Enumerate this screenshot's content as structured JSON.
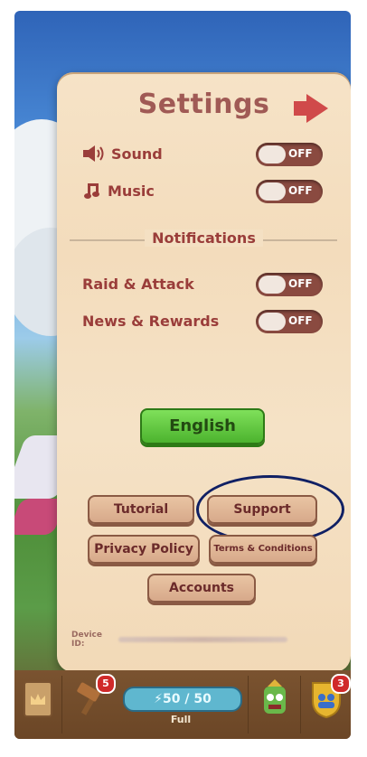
{
  "settings": {
    "title": "Settings",
    "sound_label": "Sound",
    "music_label": "Music",
    "notifications_label": "Notifications",
    "raid_attack_label": "Raid & Attack",
    "news_rewards_label": "News & Rewards",
    "toggle_off": "OFF",
    "language_button": "English",
    "tutorial_button": "Tutorial",
    "support_button": "Support",
    "privacy_button": "Privacy Policy",
    "terms_button": "Terms & Conditions",
    "accounts_button": "Accounts",
    "device_id_label": "Device ID:"
  },
  "bottom_bar": {
    "energy_text": "⚡50 / 50",
    "energy_status": "Full",
    "hammer_badge": "5",
    "team_badge": "3"
  },
  "colors": {
    "panel": "#f5e1c5",
    "title": "#a05a55",
    "label": "#9a3d3a",
    "toggle_bg": "#8a4a40",
    "green_button": "#5cc43a",
    "highlight_circle": "#102064"
  }
}
